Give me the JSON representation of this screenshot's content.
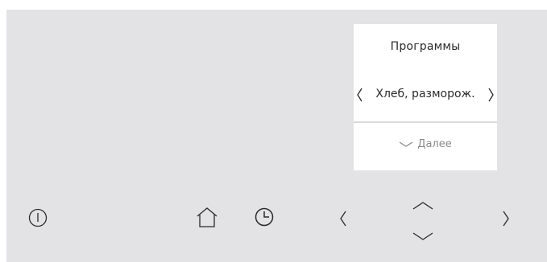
{
  "programs_card": {
    "title": "Программы",
    "selected_program": "Хлеб, разморож.",
    "more_label": "Далее"
  },
  "controls": {
    "power": "power-icon",
    "home": "home-icon",
    "timer": "clock-icon",
    "left": "chevron-left-icon",
    "up": "chevron-up-icon",
    "down": "chevron-down-icon",
    "right": "chevron-right-icon"
  },
  "colors": {
    "panel_background": "#e3e3e6",
    "card_background": "#ffffff",
    "icon_color": "#2a2a2a",
    "secondary_text": "#8a8a8a"
  }
}
